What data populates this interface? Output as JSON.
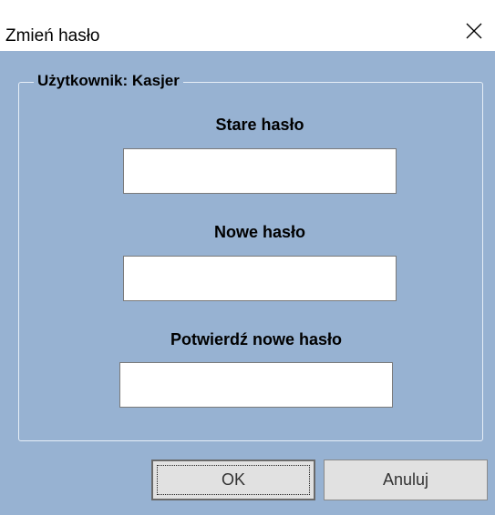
{
  "window": {
    "title": "Zmień hasło"
  },
  "group": {
    "legend": "Użytkownik:  Kasjer"
  },
  "fields": {
    "old_password": {
      "label": "Stare hasło",
      "value": ""
    },
    "new_password": {
      "label": "Nowe hasło",
      "value": ""
    },
    "confirm_password": {
      "label": "Potwierdź nowe hasło",
      "value": ""
    }
  },
  "buttons": {
    "ok_label": "OK",
    "cancel_label": "Anuluj"
  },
  "icons": {
    "close": "close-icon"
  },
  "colors": {
    "dialog_background": "#97b2d2",
    "titlebar_background": "#ffffff",
    "button_face": "#e1e1e1"
  }
}
